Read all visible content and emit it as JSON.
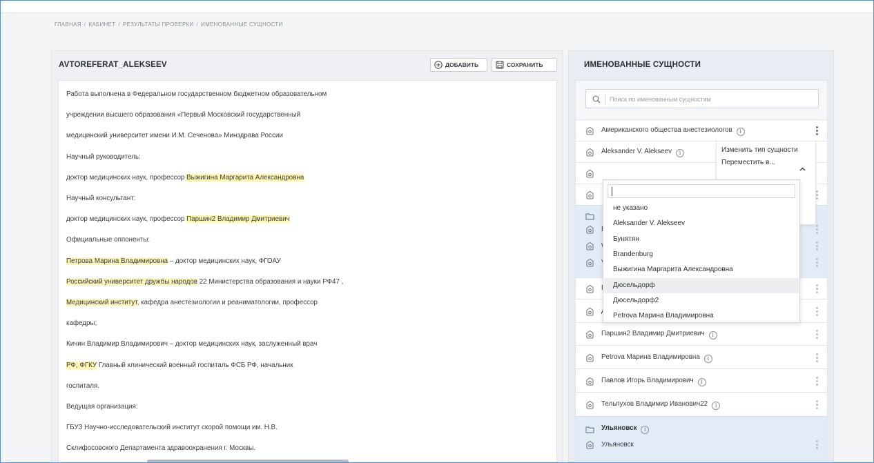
{
  "breadcrumb": [
    "ГЛАВНАЯ",
    "КАБИНЕТ",
    "РЕЗУЛЬТАТЫ ПРОВЕРКИ",
    "ИМЕНОВАННЫЕ СУЩНОСТИ"
  ],
  "document": {
    "title": "AVTOREFERAT_ALEKSEEV",
    "add_label": "ДОБАВИТЬ",
    "save_label": "СОХРАНИТЬ",
    "lines": [
      [
        {
          "t": "Работа выполнена в Федеральном государственном бюджетном образовательном"
        }
      ],
      [
        {
          "t": "учреждении высшего образования «Первый Московский государственный"
        }
      ],
      [
        {
          "t": "медицинский университет имени И.М. Сеченова» Минздрава России"
        }
      ],
      [
        {
          "t": "Научный руководитель:"
        }
      ],
      [
        {
          "t": "доктор медицинских наук, профессор "
        },
        {
          "t": "Выжигина Маргарита Александровна",
          "h": true
        }
      ],
      [
        {
          "t": "Научный консультант:"
        }
      ],
      [
        {
          "t": "доктор медицинских наук, профессор "
        },
        {
          "t": "Паршин2 Владимир Дмитриевич",
          "h": true
        }
      ],
      [
        {
          "t": "Официальные оппоненты:"
        }
      ],
      [
        {
          "t": "Петрова Марина Владимировна",
          "h": true
        },
        {
          "t": " – доктор медицинских наук, ФГОАУ"
        }
      ],
      [
        {
          "t": "Российский университет дружбы народов",
          "h": true
        },
        {
          "t": " 22 Министерства образования и науки РФ47 ,"
        }
      ],
      [
        {
          "t": "Медицинский институт",
          "h": true
        },
        {
          "t": ", кафедра анестезиологии и реаниматологии, профессор"
        }
      ],
      [
        {
          "t": "кафедры;"
        }
      ],
      [
        {
          "t": "Кичин Владимир Владимирович – доктор медицинских наук, заслуженный врач"
        }
      ],
      [
        {
          "t": "РФ, ФГКУ",
          "h": true
        },
        {
          "t": " Главный клинический военный госпиталь ФСБ РФ, начальник"
        }
      ],
      [
        {
          "t": "госпиталя."
        }
      ],
      [
        {
          "t": "Ведущая организация:"
        }
      ],
      [
        {
          "t": "ГБУЗ Научно-исследовательский институт скорой помощи им. Н.В."
        }
      ],
      [
        {
          "t": "Склифосовского Департамента здравоохранения г. Москвы."
        }
      ]
    ]
  },
  "entities": {
    "title": "ИМЕНОВАННЫЕ СУЩНОСТИ",
    "search_placeholder": "Поиск по именованным сущностям",
    "rows": {
      "r1": "Американского общества анестезиологов",
      "r2": "Aleksander V. Alekseev",
      "r3": "",
      "r4": "",
      "g1_a": "Б",
      "g1_b": "W",
      "g1_c": "V",
      "r5": "Г",
      "r6": "Д",
      "r7": "Паршин2 Владимир Дмитриевич",
      "r8": "Petrova Марина Владимировна",
      "r9": "Павлов Игорь Владимирович",
      "r10": "Тельпухов Владимир Иванович22",
      "folder2": "Ульяновск",
      "folder2_child": "Ульяновск"
    }
  },
  "context_menu": {
    "change_type": "Изменить тип сущности",
    "move_to": "Переместить в..."
  },
  "dropdown": {
    "input_value": "",
    "options": [
      "не указано",
      "Aleksander V. Alekseev",
      "Бунятян",
      "Brandenburg",
      "Выжигина Маргарита Александровна",
      "Дюсельдорф",
      "Дюсельдорф2",
      "Petrova Марина Владимировна"
    ],
    "active_index": 5
  },
  "colors": {
    "highlight": "#fdf6b5",
    "folder_bg": "#e2ecf6",
    "frame_border": "#5b8fc7"
  }
}
